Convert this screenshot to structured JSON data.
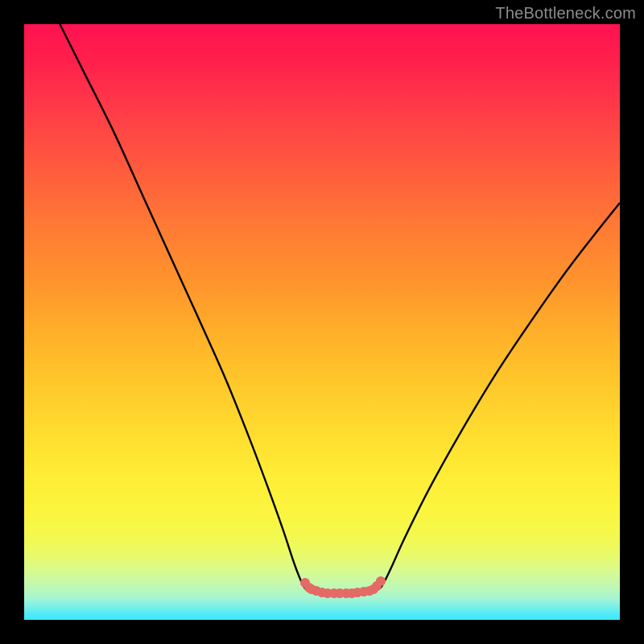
{
  "watermark": {
    "text": "TheBottleneck.com"
  },
  "chart_data": {
    "type": "line",
    "title": "",
    "xlabel": "",
    "ylabel": "",
    "xlim": [
      0,
      100
    ],
    "ylim": [
      0,
      100
    ],
    "grid": false,
    "series": [
      {
        "name": "left-curve",
        "points": [
          [
            6,
            100
          ],
          [
            10,
            92
          ],
          [
            15,
            82
          ],
          [
            20,
            71
          ],
          [
            25,
            60
          ],
          [
            30,
            49
          ],
          [
            34,
            40
          ],
          [
            38,
            30
          ],
          [
            41,
            22
          ],
          [
            43.5,
            15
          ],
          [
            45.5,
            9
          ],
          [
            47,
            5.5
          ],
          [
            48,
            4.9
          ],
          [
            48.5,
            4.9
          ]
        ]
      },
      {
        "name": "right-curve",
        "points": [
          [
            58.5,
            4.9
          ],
          [
            59,
            4.9
          ],
          [
            60,
            5.6
          ],
          [
            61.5,
            8.5
          ],
          [
            64,
            14
          ],
          [
            68,
            22
          ],
          [
            73,
            31
          ],
          [
            79,
            41
          ],
          [
            85,
            50
          ],
          [
            91,
            58.5
          ],
          [
            96,
            65
          ],
          [
            100,
            70
          ]
        ]
      }
    ],
    "markers": {
      "name": "bottleneck-points",
      "color": "#e46a66",
      "points": [
        [
          47.2,
          6.2
        ],
        [
          47.9,
          5.4
        ],
        [
          48.3,
          5.1
        ],
        [
          49.0,
          4.8
        ],
        [
          50.0,
          4.6
        ],
        [
          51.0,
          4.5
        ],
        [
          52.0,
          4.5
        ],
        [
          53.0,
          4.5
        ],
        [
          54.0,
          4.5
        ],
        [
          55.0,
          4.5
        ],
        [
          56.0,
          4.6
        ],
        [
          57.0,
          4.7
        ],
        [
          58.0,
          4.9
        ],
        [
          58.6,
          5.2
        ],
        [
          59.2,
          5.7
        ],
        [
          59.8,
          6.5
        ]
      ]
    },
    "gradient_stops": [
      {
        "pct": 0,
        "hex": "#ff1250"
      },
      {
        "pct": 50,
        "hex": "#ffb029"
      },
      {
        "pct": 82,
        "hex": "#fbf53f"
      },
      {
        "pct": 100,
        "hex": "#3de8fb"
      }
    ]
  }
}
